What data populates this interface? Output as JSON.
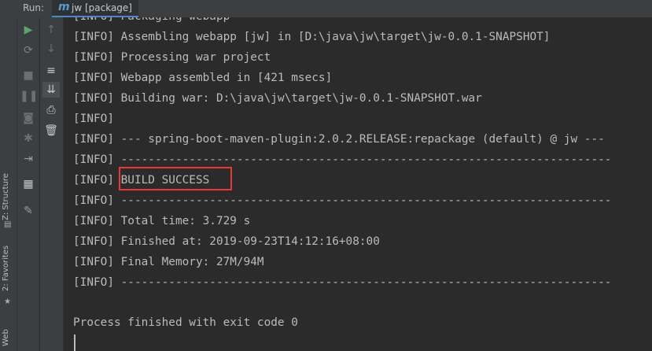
{
  "tab_bar": {
    "run_label": "Run:",
    "tab_icon": "maven-m-icon",
    "tab_icon_glyph": "m",
    "tab_title": "jw [package]"
  },
  "side_tabs": {
    "structure": "Z: Structure",
    "favorites": "2: Favorites",
    "web": "Web"
  },
  "toolbar_icons": [
    "run-icon",
    "rerun-icon",
    "stop-icon",
    "pause-icon",
    "camera-icon",
    "debug-icon",
    "exit-icon",
    "layout-icon",
    "pin-icon",
    "up-arrow-icon",
    "down-arrow-icon",
    "soft-wrap-icon",
    "scroll-to-end-icon",
    "print-icon",
    "trash-icon"
  ],
  "console": {
    "lines": [
      "[INFO] Packaging webapp",
      "[INFO] Assembling webapp [jw] in [D:\\java\\jw\\target\\jw-0.0.1-SNAPSHOT]",
      "[INFO] Processing war project",
      "[INFO] Webapp assembled in [421 msecs]",
      "[INFO] Building war: D:\\java\\jw\\target\\jw-0.0.1-SNAPSHOT.war",
      "[INFO]",
      "[INFO] --- spring-boot-maven-plugin:2.0.2.RELEASE:repackage (default) @ jw ---",
      "[INFO] ------------------------------------------------------------------------",
      "[INFO] BUILD SUCCESS",
      "[INFO] ------------------------------------------------------------------------",
      "[INFO] Total time: 3.729 s",
      "[INFO] Finished at: 2019-09-23T14:12:16+08:00",
      "[INFO] Final Memory: 27M/94M",
      "[INFO] ------------------------------------------------------------------------"
    ],
    "exit_message": "Process finished with exit code 0",
    "highlight_color": "#e53935"
  }
}
